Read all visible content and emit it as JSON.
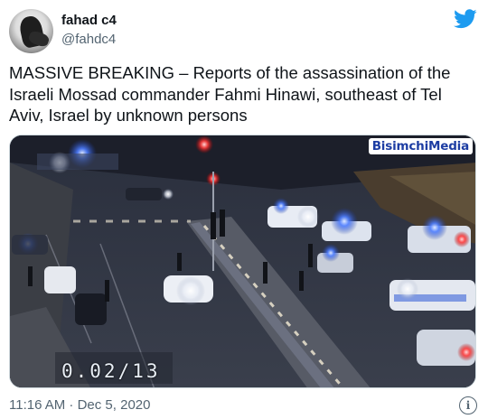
{
  "tweet": {
    "author_name": "fahad c4",
    "author_handle": "@fahdc4",
    "text": "MASSIVE BREAKING – Reports of the assassination of the Israeli Mossad commander Fahmi Hinawi, southeast of Tel Aviv, Israel by unknown persons",
    "timestamp": "11:16 AM · Dec 5, 2020"
  },
  "media": {
    "watermark": "BisimchiMedia",
    "video_timer": "0.02/13"
  },
  "icons": {
    "brand": "twitter-bird-icon",
    "info": "info-icon",
    "brand_color": "#1d9bf0"
  },
  "colors": {
    "text": "#0f1419",
    "secondary": "#536471",
    "watermark": "#1d3da3"
  }
}
